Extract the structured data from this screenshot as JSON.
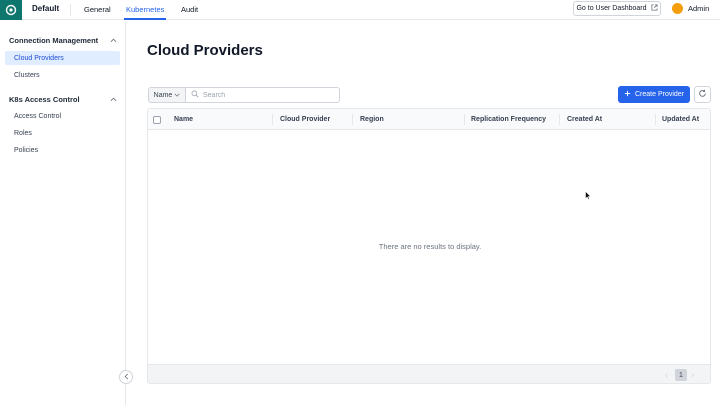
{
  "topbar": {
    "brand": "Default",
    "tabs": [
      {
        "label": "General",
        "active": false
      },
      {
        "label": "Kubernetes",
        "active": true
      },
      {
        "label": "Audit",
        "active": false
      }
    ],
    "user_dashboard_label": "Go to User Dashboard",
    "user_label": "Admin"
  },
  "sidebar": {
    "sections": [
      {
        "title": "Connection Management",
        "items": [
          {
            "label": "Cloud Providers",
            "active": true
          },
          {
            "label": "Clusters",
            "active": false
          }
        ]
      },
      {
        "title": "K8s Access Control",
        "items": [
          {
            "label": "Access Control",
            "active": false
          },
          {
            "label": "Roles",
            "active": false
          },
          {
            "label": "Policies",
            "active": false
          }
        ]
      }
    ]
  },
  "main": {
    "title": "Cloud Providers",
    "filter_field": "Name",
    "search_placeholder": "Search",
    "create_label": "Create Provider",
    "columns": [
      "Name",
      "Cloud Provider",
      "Region",
      "Replication Frequency",
      "Created At",
      "Updated At"
    ],
    "empty_text": "There are no results to display.",
    "current_page": "1"
  },
  "colors": {
    "accent": "#2563eb",
    "brand": "#0f766e",
    "active_bg": "#e0ecff"
  }
}
